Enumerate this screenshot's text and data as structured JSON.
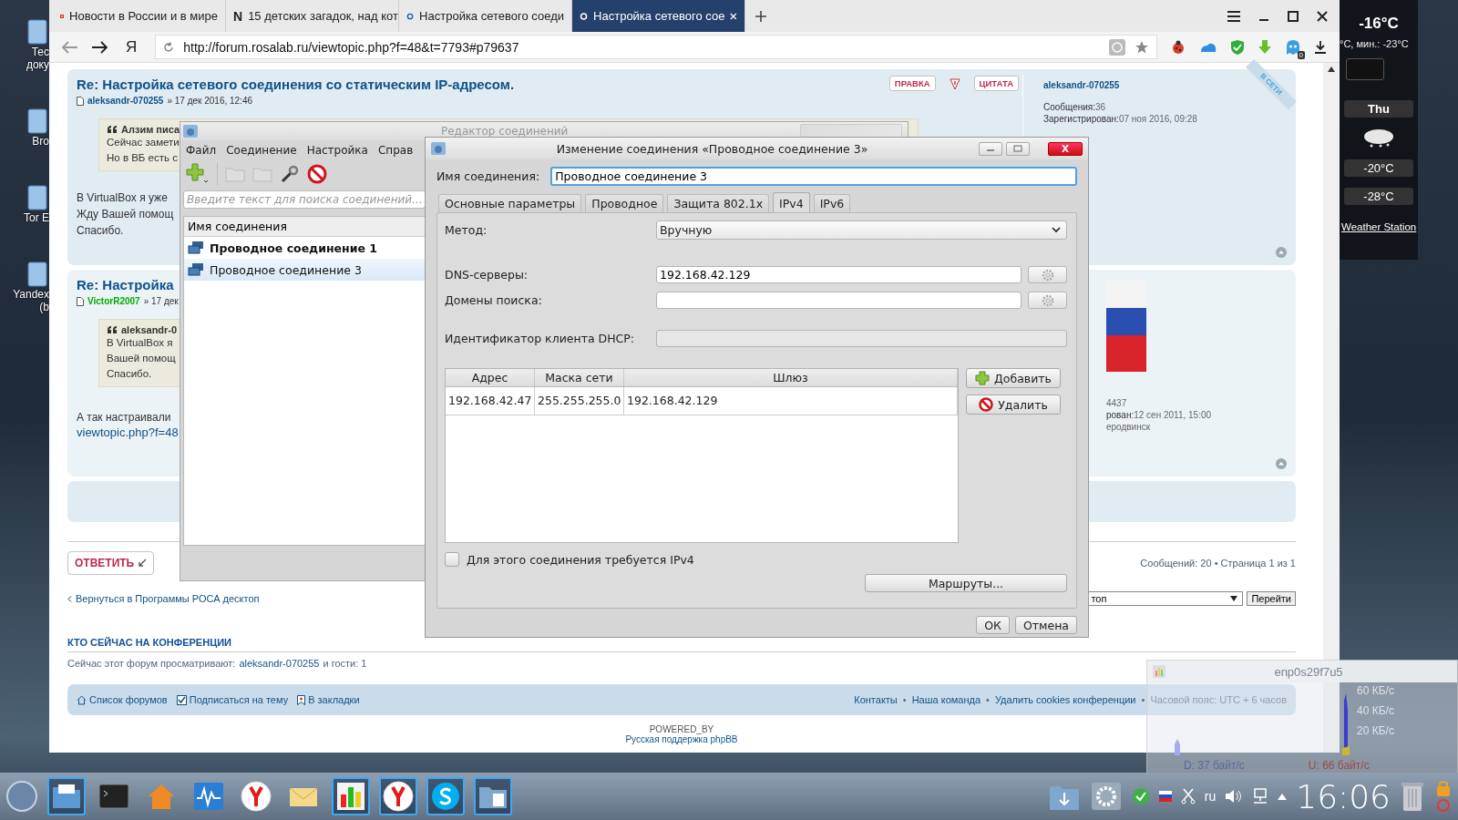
{
  "desktop_icons": [
    {
      "lines": [
        "Тес",
        "доку"
      ]
    },
    {
      "lines": [
        "Bro"
      ]
    },
    {
      "lines": [
        "Tor E"
      ]
    },
    {
      "lines": [
        "Yandex",
        "(b"
      ]
    }
  ],
  "browser": {
    "tabs": [
      {
        "title": "Новости в России и в мире",
        "kind": "news",
        "selected": false
      },
      {
        "title": "15 детских загадок, над кот",
        "kind": "letter",
        "selected": false
      },
      {
        "title": "Настройка сетевого соеди",
        "kind": "forum",
        "selected": false
      },
      {
        "title": "Настройка сетевого сое",
        "kind": "forum",
        "selected": true
      }
    ],
    "tab_letter": "N",
    "home_logo": "Я",
    "url": "http://forum.rosalab.ru/viewtopic.php?f=48&t=7793#p79637",
    "extension_badge": "0"
  },
  "forum": {
    "posts": [
      {
        "title": "Re: Настройка сетевого соединения со статическим IP-адресом.",
        "author": "aleksandr-070255",
        "kind": "member",
        "date": "» 17 дек 2016, 12:46",
        "actions": [
          "ПРАВКА",
          "ЦИТАТА"
        ],
        "quote": {
          "author": "Алзим писа",
          "lines": [
            "Сейчас замети",
            "Но в ВБ есть с"
          ]
        },
        "body": [
          "В VirtualBox я уже",
          "Жду Вашей помощ",
          "Спасибо."
        ],
        "profile": {
          "online": "В СЕТИ",
          "name": "aleksandr-070255",
          "stats": [
            {
              "label": "Сообщения:",
              "value": "36"
            },
            {
              "label": "Зарегистрирован:",
              "value": "07 ноя 2016, 09:28"
            }
          ]
        }
      },
      {
        "title": "Re: Настройка",
        "author": "VictorR2007",
        "kind": "moderator",
        "date": "» 17 дек",
        "quote": {
          "author": "aleksandr-0",
          "lines": [
            "В VirtualBox я",
            "Вашей помощ",
            "Спасибо."
          ]
        },
        "body": [
          "А так настраивали"
        ],
        "link": "viewtopic.php?f=48",
        "profile": {
          "avatar": true,
          "stats": [
            {
              "value": "4437"
            },
            {
              "label": "рован:",
              "value": "12 сен 2011, 15:00"
            },
            {
              "value": "еродвинск"
            }
          ]
        }
      }
    ],
    "reply_button": "ОТВЕТИТЬ",
    "pagination": "Сообщений: 20 • Страница 1 из 1",
    "back_link": "Вернуться в Программы РОСА десктоп",
    "jump_select": "топ",
    "jump_button": "Перейти",
    "online_heading": "КТО СЕЙЧАС НА КОНФЕРЕНЦИИ",
    "online_text": "Сейчас этот форум просматривают:",
    "online_user": "aleksandr-070255",
    "online_guests": "и гости: 1",
    "footer_left": [
      {
        "label": "Список форумов",
        "kind": "home"
      },
      {
        "label": "Подписаться на тему",
        "kind": "check"
      },
      {
        "label": "В закладки",
        "kind": "bookmark"
      }
    ],
    "footer_right": [
      "Контакты",
      "Наша команда",
      "Удалить cookies конференции"
    ],
    "separator": "•",
    "timezone": "Часовой пояс: UTC + 6 часов",
    "powered_by": "POWERED_BY",
    "powered_link": "Русская поддержка phpBB"
  },
  "connection_editor": {
    "title": "Редактор соединений",
    "menu": [
      "Файл",
      "Соединение",
      "Настройка",
      "Справ"
    ],
    "search_placeholder": "Введите текст для поиска соединений...",
    "column": "Имя соединения",
    "connections": [
      {
        "name": "Проводное соединение 1",
        "active": true,
        "selected": false
      },
      {
        "name": "Проводное соединение 3",
        "active": false,
        "selected": true
      }
    ]
  },
  "dialog": {
    "title": "Изменение соединения «Проводное соединение 3»",
    "name_label": "Имя соединения:",
    "name_value": "Проводное соединение 3",
    "tabs": [
      {
        "label": "Основные параметры",
        "selected": false
      },
      {
        "label": "Проводное",
        "selected": false
      },
      {
        "label": "Защита 802.1x",
        "selected": false
      },
      {
        "label": "IPv4",
        "selected": true
      },
      {
        "label": "IPv6",
        "selected": false
      }
    ],
    "method_label": "Метод:",
    "method_value": "Вручную",
    "dns_label": "DNS-серверы:",
    "dns_value": "192.168.42.129",
    "domains_label": "Домены поиска:",
    "dhcp_label": "Идентификатор клиента DHCP:",
    "dhcp_disabled": true,
    "table": {
      "columns": [
        "Адрес",
        "Маска сети",
        "Шлюз"
      ],
      "rows": [
        [
          "192.168.42.47",
          "255.255.255.0",
          "192.168.42.129"
        ]
      ]
    },
    "add_button": "Добавить",
    "remove_button": "Удалить",
    "require_ipv4": {
      "label": "Для этого соединения требуется IPv4",
      "checked": false
    },
    "routes_button": "Маршруты...",
    "ok_button": "ОК",
    "cancel_button": "Отмена"
  },
  "weather": {
    "current": "-16°C",
    "range": "°C, мин.: -23°C",
    "day": "Thu",
    "high": "-20°C",
    "low": "-28°C",
    "link": "Weather Station"
  },
  "net_monitor": {
    "title": "enp0s29f7u5",
    "ticks": [
      "60 КБ/с",
      "40 КБ/с",
      "20 КБ/с"
    ],
    "download": "D: 37 байт/с",
    "upload": "U: 66 байт/с"
  },
  "taskbar": {
    "apps": [
      {
        "kind": "files",
        "active": true
      },
      {
        "kind": "terminal",
        "active": false
      },
      {
        "kind": "home",
        "active": false
      },
      {
        "kind": "monitor",
        "active": false
      },
      {
        "kind": "yandex",
        "active": false
      },
      {
        "kind": "mail",
        "active": false
      },
      {
        "kind": "chart",
        "active": true
      },
      {
        "kind": "yandex",
        "active": true
      },
      {
        "kind": "skype",
        "active": true
      },
      {
        "kind": "netfolder",
        "active": true
      }
    ],
    "language": "ru",
    "clock": "16:06"
  }
}
